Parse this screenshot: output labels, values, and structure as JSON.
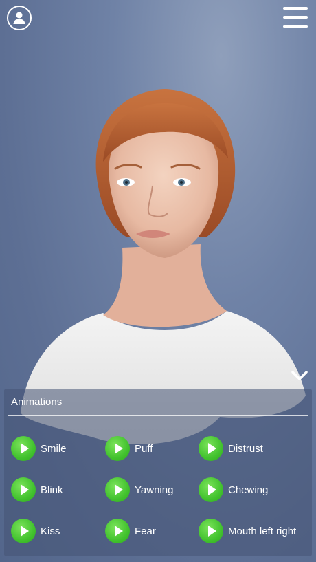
{
  "header": {
    "profile_icon": "user-icon",
    "menu_icon": "hamburger-icon"
  },
  "panel": {
    "collapse_icon": "chevron-down-icon",
    "title": "Animations",
    "animations": [
      {
        "label": "Smile"
      },
      {
        "label": "Puff"
      },
      {
        "label": "Distrust"
      },
      {
        "label": "Blink"
      },
      {
        "label": "Yawning"
      },
      {
        "label": "Chewing"
      },
      {
        "label": "Kiss"
      },
      {
        "label": "Fear"
      },
      {
        "label": "Mouth left right"
      }
    ]
  },
  "colors": {
    "accent_green": "#42c22e",
    "background": "#6f82a6"
  }
}
